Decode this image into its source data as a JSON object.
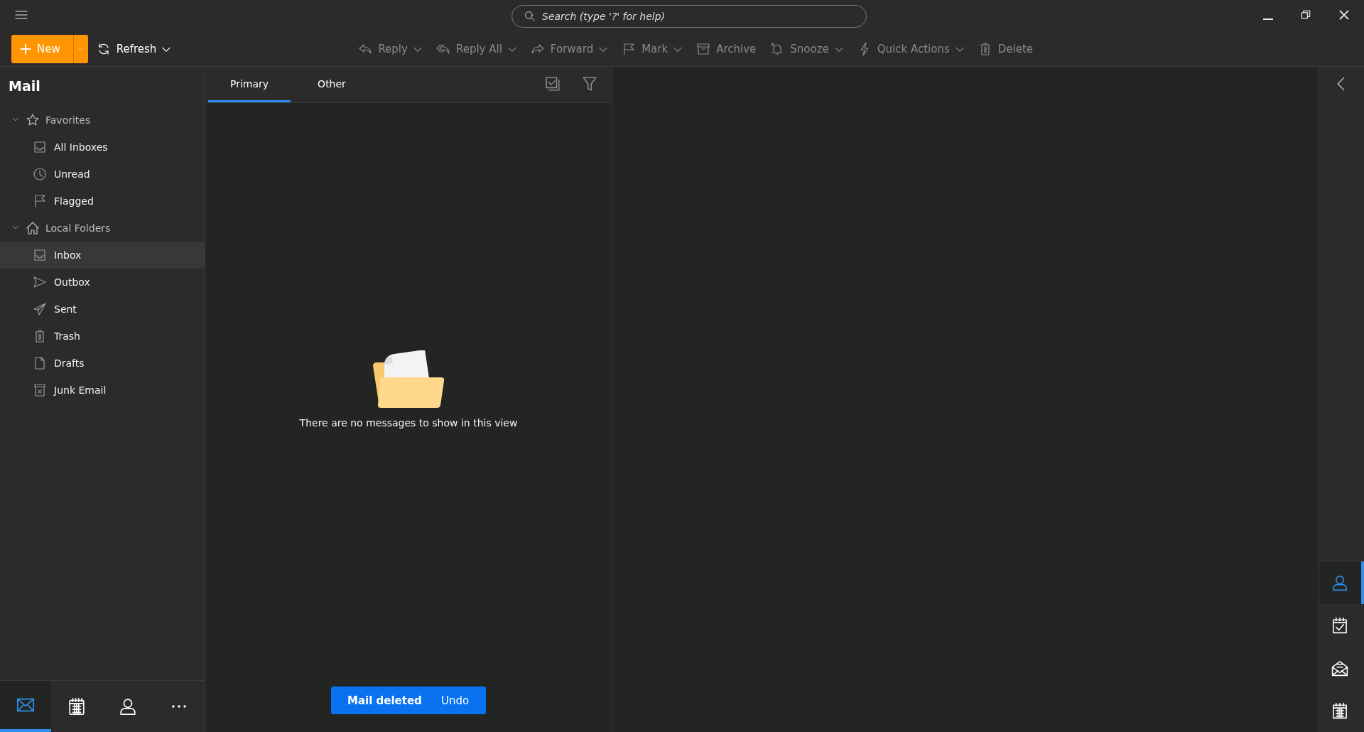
{
  "search": {
    "placeholder": "Search (type '?' for help)"
  },
  "new_button": {
    "label": "New"
  },
  "toolbar": [
    {
      "label": "Refresh",
      "disabled": false,
      "menu": true
    },
    {
      "label": "Reply",
      "disabled": true,
      "menu": true
    },
    {
      "label": "Reply All",
      "disabled": true,
      "menu": true
    },
    {
      "label": "Forward",
      "disabled": true,
      "menu": true
    },
    {
      "label": "Mark",
      "disabled": true,
      "menu": true
    },
    {
      "label": "Archive",
      "disabled": true,
      "menu": false
    },
    {
      "label": "Snooze",
      "disabled": true,
      "menu": true
    },
    {
      "label": "Quick Actions",
      "disabled": true,
      "menu": true
    },
    {
      "label": "Delete",
      "disabled": true,
      "menu": false
    }
  ],
  "sidebar": {
    "title": "Mail",
    "groups": [
      {
        "label": "Favorites",
        "expanded": true,
        "children": [
          {
            "label": "All Inboxes",
            "selected": false
          },
          {
            "label": "Unread",
            "selected": false
          },
          {
            "label": "Flagged",
            "selected": false
          }
        ]
      },
      {
        "label": "Local Folders",
        "expanded": true,
        "children": [
          {
            "label": "Inbox",
            "selected": true
          },
          {
            "label": "Outbox",
            "selected": false
          },
          {
            "label": "Sent",
            "selected": false
          },
          {
            "label": "Trash",
            "selected": false
          },
          {
            "label": "Drafts",
            "selected": false
          },
          {
            "label": "Junk Email",
            "selected": false
          }
        ]
      }
    ]
  },
  "bottom_nav": [
    {
      "selected": true
    },
    {
      "selected": false
    },
    {
      "selected": false
    },
    {
      "selected": false
    }
  ],
  "tabs": [
    {
      "label": "Primary",
      "selected": true
    },
    {
      "label": "Other",
      "selected": false
    }
  ],
  "empty_message": "There are no messages to show in this view",
  "toast": {
    "message": "Mail deleted",
    "action": "Undo"
  },
  "right_rail": [
    {
      "selected": true
    },
    {
      "selected": false
    },
    {
      "selected": false
    },
    {
      "selected": false
    }
  ]
}
